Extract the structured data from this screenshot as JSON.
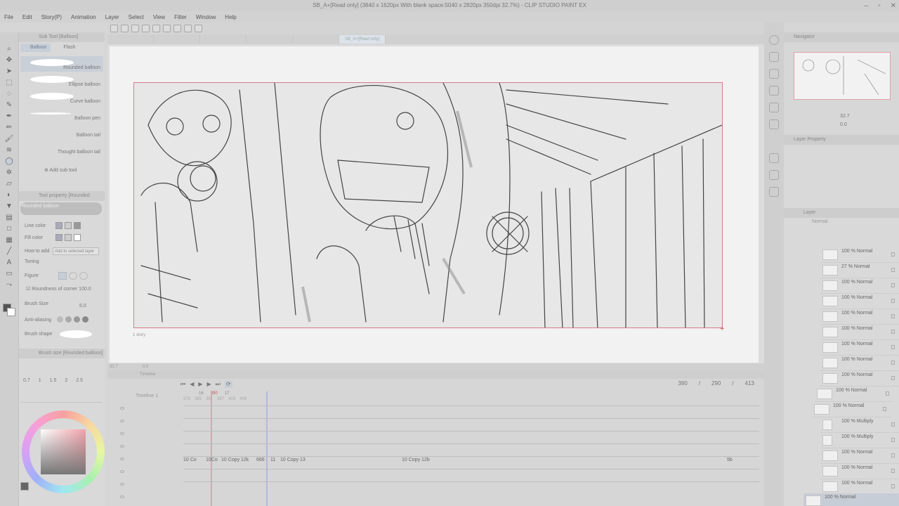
{
  "window": {
    "title": "SB_A+[Read only] (3840 x 1620px With blank space:5040 x 2820px 350dpi 32.7%) - CLIP STUDIO PAINT EX"
  },
  "menu": [
    "File",
    "Edit",
    "Story(P)",
    "Animation",
    "Layer",
    "Select",
    "View",
    "Filter",
    "Window",
    "Help"
  ],
  "canvas_tabs": [
    "",
    "",
    "",
    "",
    "",
    "SB_A+[Read only]"
  ],
  "subtool": {
    "panel_title": "Sub Tool [Balloon]",
    "tabs": [
      "Balloon",
      "Flash"
    ],
    "items": [
      "Rounded balloon",
      "Ellipse balloon",
      "Curve balloon",
      "Balloon pen",
      "Balloon tail",
      "Thought balloon tail"
    ],
    "add_label": "Add sub tool"
  },
  "tool_property": {
    "title": "Tool property [Rounded balloon]",
    "preset": "Rounded balloon",
    "line_color": "Line color",
    "fill_color": "Fill color",
    "how_to_add": "How to add",
    "how_to_add_value": "Add to selected layer",
    "toning": "Toning",
    "figure": "Figure",
    "roundness": "Roundness of corner",
    "roundness_value": "100.0",
    "brush_size": "Brush Size",
    "brush_size_value": "5.0",
    "anti_aliasing": "Anti-aliasing",
    "brush_shape": "Brush shape"
  },
  "brush_size_panel": {
    "title": "Brush size [Rounded balloon]",
    "sizes": [
      "0.7",
      "1",
      "1.5",
      "2",
      "2.5"
    ]
  },
  "canvas": {
    "caption": "1 story",
    "zoom": "32.7",
    "angle": "0.0"
  },
  "timeline": {
    "title": "Timeline",
    "name": "Timeline 1",
    "counter_current": "390",
    "counter_sep": "/",
    "counter_end": "290",
    "counter_total": "413",
    "ruler": [
      "379",
      "385",
      "391",
      "397",
      "403",
      "409"
    ],
    "ruler_marks": [
      "16",
      "390",
      "17"
    ],
    "clips": [
      "10 Co",
      "10Co",
      "10 Copy 12k",
      "666",
      "11",
      "10 Copy 13",
      "10 Copy 12b",
      "5b"
    ]
  },
  "navigator": {
    "title": "Navigator",
    "zoom": "32.7",
    "angle": "0.0"
  },
  "layer_property": {
    "title": "Layer Property"
  },
  "layer_panel": {
    "title": "Layer",
    "blend": "Normal",
    "layers": [
      {
        "pct": "100 % Normal"
      },
      {
        "pct": "27 % Normal"
      },
      {
        "pct": "100 % Normal"
      },
      {
        "pct": "100 % Normal"
      },
      {
        "pct": "100 % Normal"
      },
      {
        "pct": "100 % Normal"
      },
      {
        "pct": "100 % Normal"
      },
      {
        "pct": "100 % Normal"
      },
      {
        "pct": "100 % Normal"
      },
      {
        "pct": "100 % Normal"
      },
      {
        "pct": "100 % Normal"
      },
      {
        "pct": "100 % Multiply"
      },
      {
        "pct": "100 % Multiply"
      },
      {
        "pct": "100 % Normal"
      },
      {
        "pct": "100 % Normal"
      },
      {
        "pct": "100 % Normal"
      },
      {
        "pct": "100 % Normal"
      }
    ]
  },
  "colors": {
    "accent_red": "#d7798a",
    "selection_blue": "#c7cdd6"
  }
}
